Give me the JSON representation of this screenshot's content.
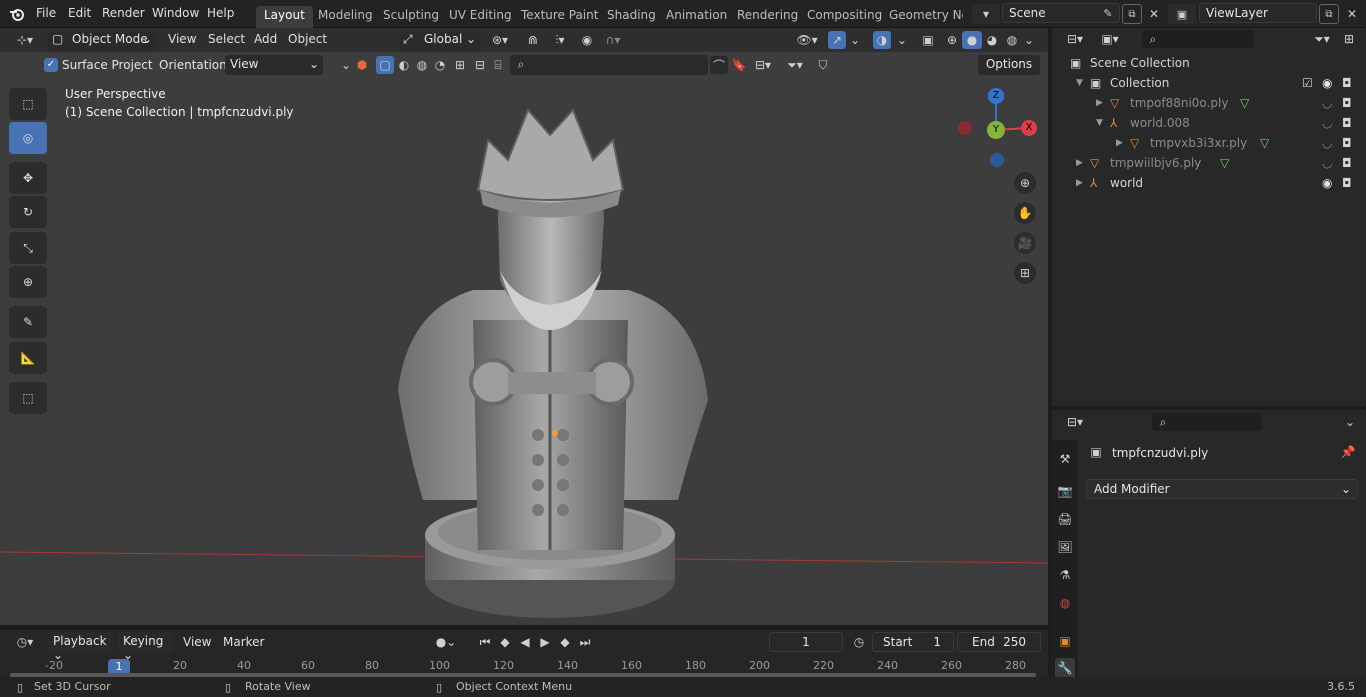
{
  "app": {
    "version": "3.6.5"
  },
  "menubar": {
    "items": [
      "File",
      "Edit",
      "Render",
      "Window",
      "Help"
    ],
    "workspaces": [
      "Layout",
      "Modeling",
      "Sculpting",
      "UV Editing",
      "Texture Paint",
      "Shading",
      "Animation",
      "Rendering",
      "Compositing",
      "Geometry Noc"
    ],
    "active_workspace": "Layout",
    "scene": "Scene",
    "view_layer": "ViewLayer"
  },
  "viewport_header": {
    "mode": "Object Mode",
    "menus": [
      "View",
      "Select",
      "Add",
      "Object"
    ],
    "transform_orientation": "Global",
    "surface_project_label": "Surface Project",
    "orientation_label": "Orientation:",
    "orientation_value": "View",
    "options_label": "Options"
  },
  "viewport": {
    "perspective_text": "User Perspective",
    "collection_text": "(1) Scene Collection | tmpfcnzudvi.ply",
    "gizmo_axes": {
      "z": "Z",
      "y": "Y",
      "x": "X"
    }
  },
  "outliner": {
    "items": [
      {
        "label": "Scene Collection",
        "indent": 0
      },
      {
        "label": "Collection",
        "indent": 1
      },
      {
        "label": "tmpof88ni0o.ply",
        "indent": 2
      },
      {
        "label": "world.008",
        "indent": 2
      },
      {
        "label": "tmpvxb3i3xr.ply",
        "indent": 3
      },
      {
        "label": "tmpwiilbjv6.ply",
        "indent": 1
      },
      {
        "label": "world",
        "indent": 1
      }
    ]
  },
  "properties": {
    "object_name": "tmpfcnzudvi.ply",
    "add_modifier_label": "Add Modifier"
  },
  "timeline": {
    "menus": [
      "Playback",
      "Keying",
      "View",
      "Marker"
    ],
    "current_frame": "1",
    "start_label": "Start",
    "start_value": "1",
    "end_label": "End",
    "end_value": "250",
    "ruler_ticks": [
      "-20",
      "1",
      "20",
      "40",
      "60",
      "80",
      "100",
      "120",
      "140",
      "160",
      "180",
      "200",
      "220",
      "240",
      "260",
      "280"
    ]
  },
  "statusbar": {
    "hints": [
      "Set 3D Cursor",
      "Rotate View",
      "Object Context Menu"
    ]
  },
  "colors": {
    "accent": "#4772b3",
    "axis_x": "#e03c4a",
    "axis_y": "#86b33b",
    "axis_z": "#2f77d1"
  }
}
